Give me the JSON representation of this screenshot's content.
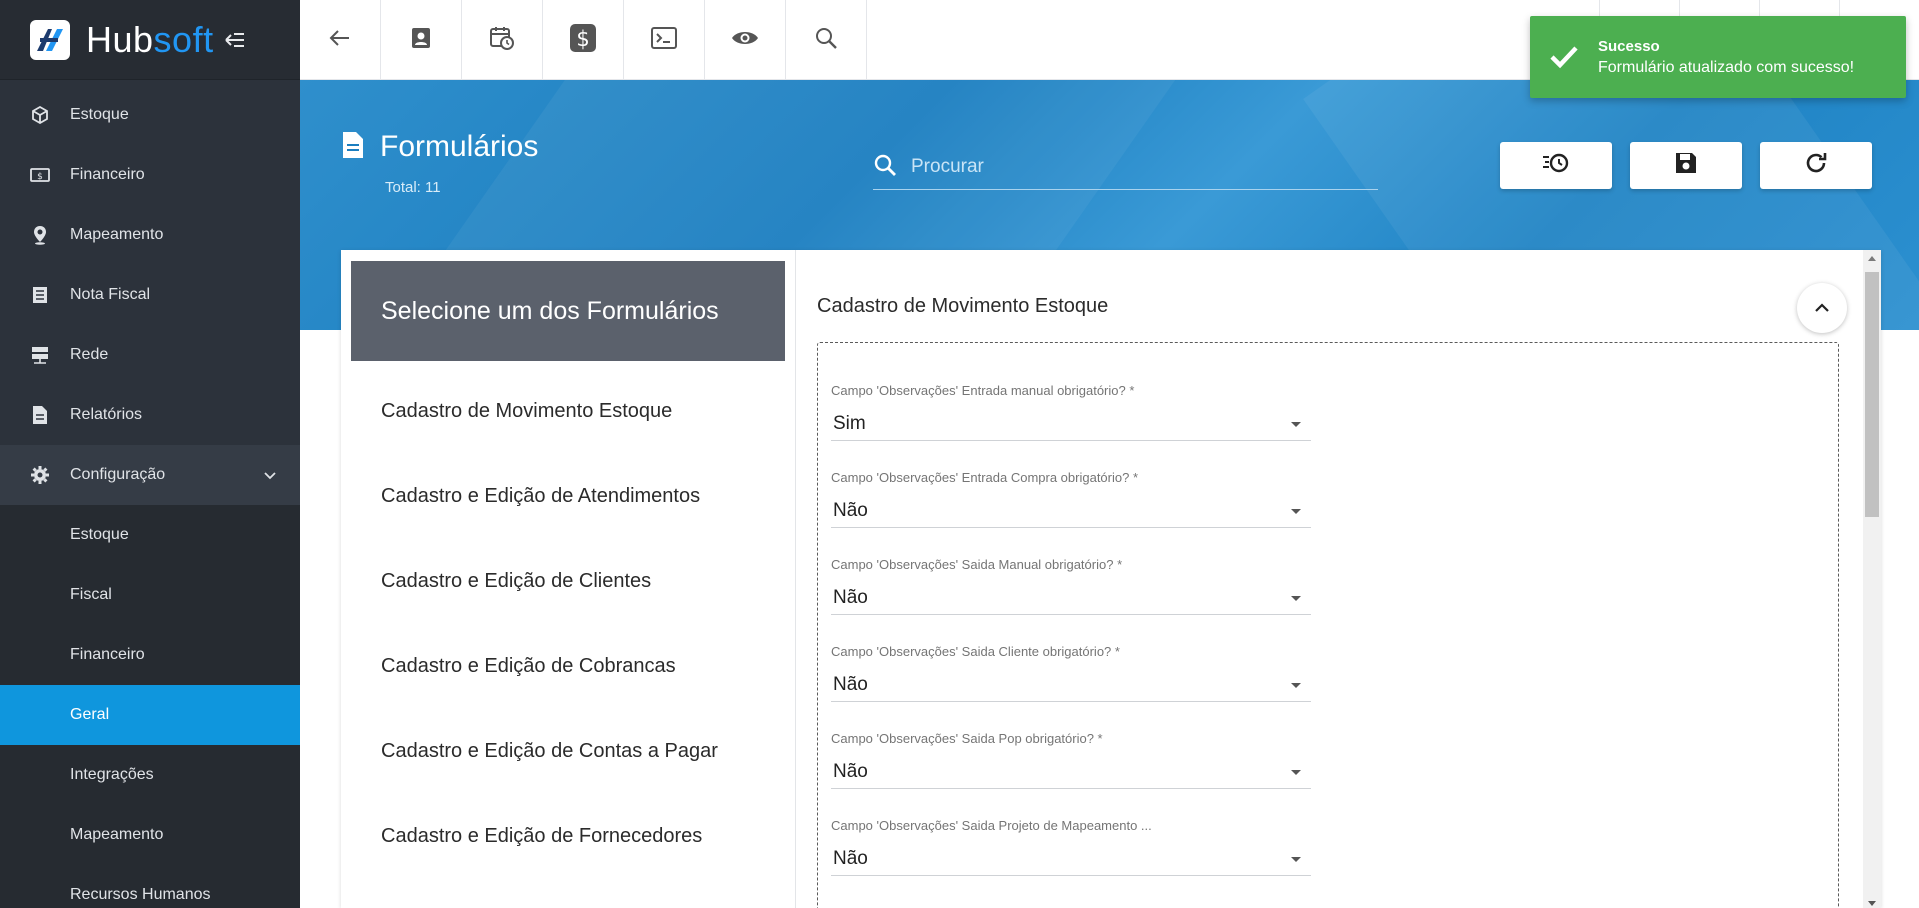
{
  "brand": {
    "name_part1": "Hub",
    "name_part2": "soft"
  },
  "sidebar": {
    "items": [
      {
        "label": "Estoque",
        "icon": "box-icon"
      },
      {
        "label": "Financeiro",
        "icon": "money-icon"
      },
      {
        "label": "Mapeamento",
        "icon": "map-pin-icon"
      },
      {
        "label": "Nota Fiscal",
        "icon": "list-icon"
      },
      {
        "label": "Rede",
        "icon": "server-icon"
      },
      {
        "label": "Relatórios",
        "icon": "file-icon"
      },
      {
        "label": "Configuração",
        "icon": "gear-icon"
      }
    ],
    "subitems": [
      {
        "label": "Estoque"
      },
      {
        "label": "Fiscal"
      },
      {
        "label": "Financeiro"
      },
      {
        "label": "Geral"
      },
      {
        "label": "Integrações"
      },
      {
        "label": "Mapeamento"
      },
      {
        "label": "Recursos Humanos"
      }
    ]
  },
  "page": {
    "title": "Formulários",
    "total": "Total: 11",
    "search_placeholder": "Procurar"
  },
  "list": {
    "header": "Selecione um dos Formulários",
    "items": [
      "Cadastro de Movimento Estoque",
      "Cadastro e Edição de Atendimentos",
      "Cadastro e Edição de Clientes",
      "Cadastro e Edição de Cobrancas",
      "Cadastro e Edição de Contas a Pagar",
      "Cadastro e Edição de Fornecedores"
    ]
  },
  "detail": {
    "title": "Cadastro de Movimento Estoque",
    "fields": [
      {
        "label": "Campo 'Observações' Entrada manual obrigatório? *",
        "value": "Sim"
      },
      {
        "label": "Campo 'Observações' Entrada Compra obrigatório? *",
        "value": "Não"
      },
      {
        "label": "Campo 'Observações' Saida Manual obrigatório? *",
        "value": "Não"
      },
      {
        "label": "Campo 'Observações' Saida Cliente obrigatório? *",
        "value": "Não"
      },
      {
        "label": "Campo 'Observações' Saida Pop obrigatório? *",
        "value": "Não"
      },
      {
        "label": "Campo 'Observações' Saida Projeto de Mapeamento ...",
        "value": "Não"
      }
    ]
  },
  "toast": {
    "title": "Sucesso",
    "message": "Formulário atualizado com sucesso!"
  },
  "colors": {
    "accent": "#0f96dd",
    "sidebar": "#2c323b",
    "success": "#4caf50",
    "list_header": "#5b616c"
  }
}
